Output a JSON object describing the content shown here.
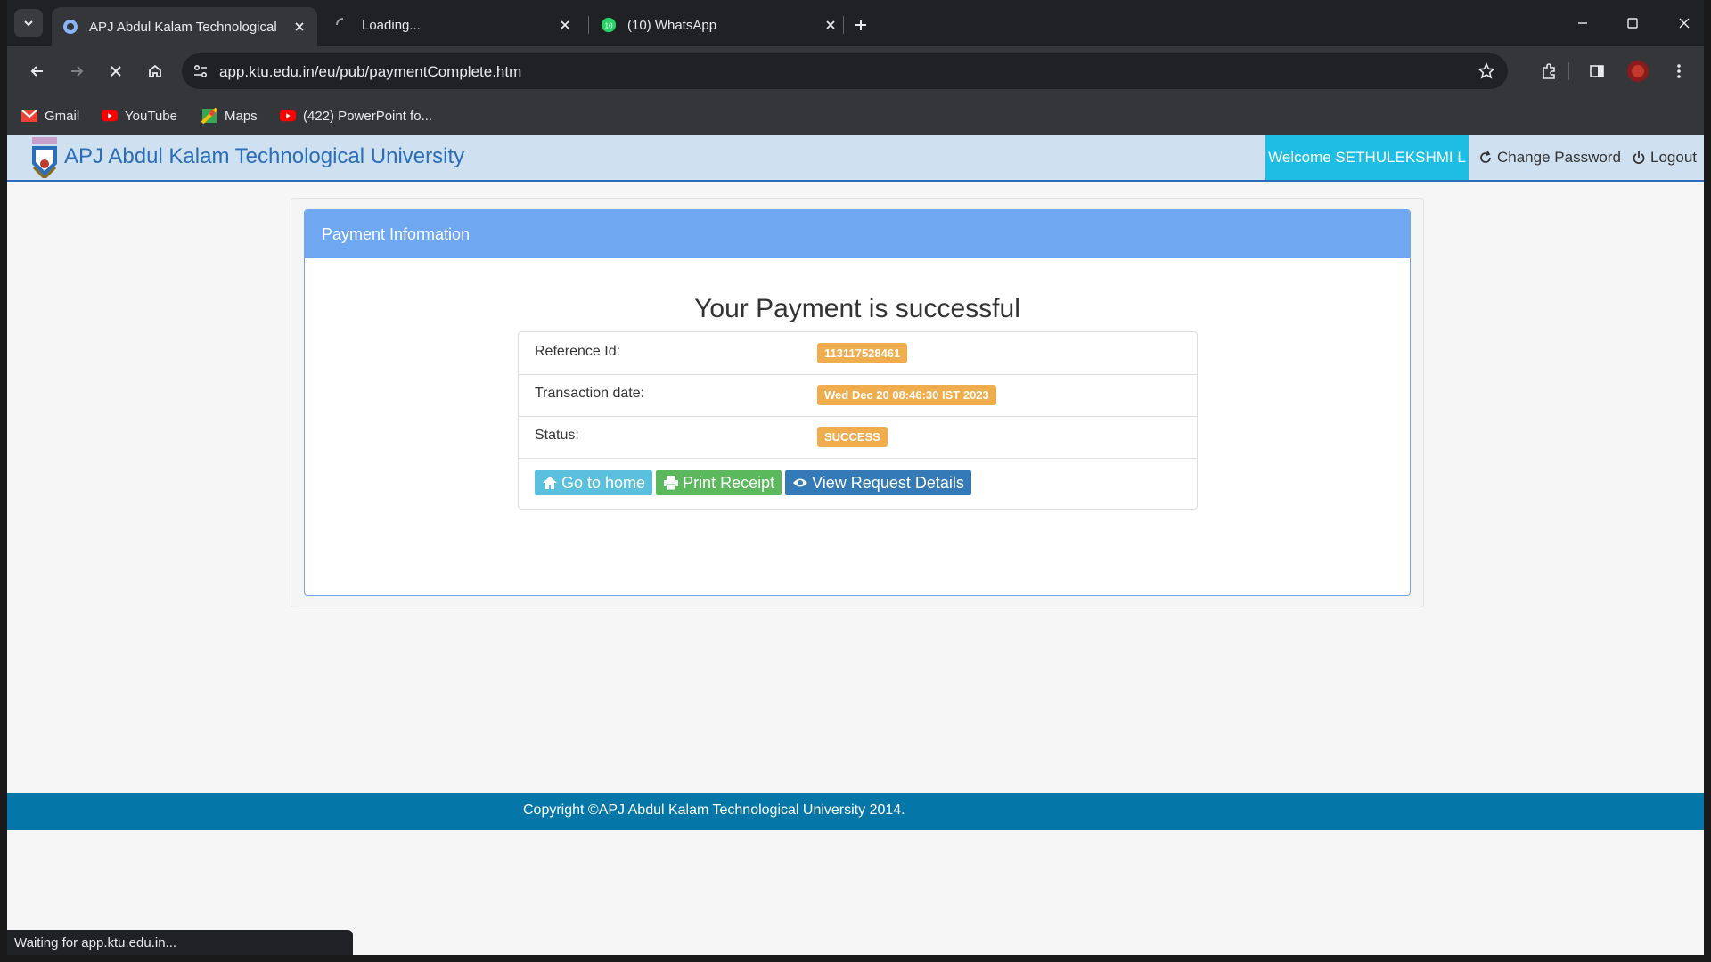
{
  "browser": {
    "tabs": [
      {
        "title": "APJ Abdul Kalam Technological",
        "active": true
      },
      {
        "title": "Loading...",
        "active": false
      },
      {
        "title": "(10) WhatsApp",
        "active": false
      }
    ],
    "whatsapp_badge": "10",
    "url": "app.ktu.edu.in/eu/pub/paymentComplete.htm",
    "bookmarks": [
      "Gmail",
      "YouTube",
      "Maps",
      "(422) PowerPoint fo..."
    ],
    "status_text": "Waiting for app.ktu.edu.in..."
  },
  "site": {
    "brand": "APJ Abdul Kalam Technological University",
    "welcome": "Welcome SETHULEKSHMI L",
    "change_password": "Change Password",
    "logout": "Logout"
  },
  "panel": {
    "heading": "Payment Information",
    "title": "Your Payment is successful",
    "rows": [
      {
        "label": "Reference Id:",
        "value": "113117528461"
      },
      {
        "label": "Transaction date:",
        "value": "Wed Dec 20 08:46:30 IST 2023"
      },
      {
        "label": "Status:",
        "value": "SUCCESS"
      }
    ],
    "buttons": {
      "home": "Go to home",
      "print": "Print Receipt",
      "view": "View Request Details"
    }
  },
  "footer": {
    "copyright": "Copyright ©APJ Abdul Kalam Technological University 2014."
  },
  "colors": {
    "header_bg": "#cfe0f1",
    "brand": "#2a6db8",
    "welcome_bg": "#1ebde3",
    "panel_heading": "#6fa8f0",
    "badge": "#f0ad4e",
    "btn_home": "#5bc0de",
    "btn_print": "#5cb85c",
    "btn_view": "#337ab7",
    "footer": "#0576a8"
  }
}
